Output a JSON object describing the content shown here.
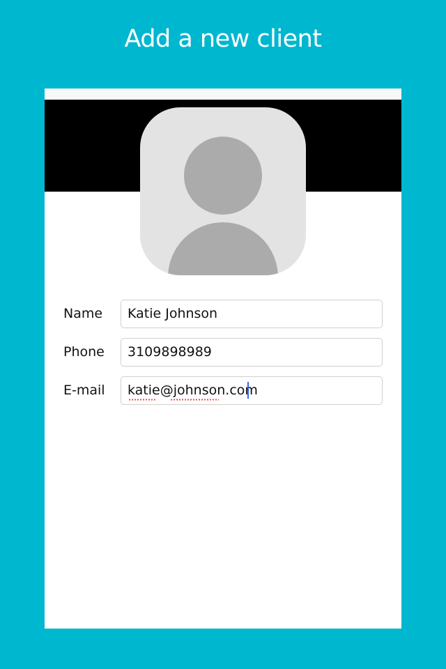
{
  "page": {
    "title": "Add a new client"
  },
  "colors": {
    "background": "#00B7D0",
    "card": "#FFFFFF",
    "header_band": "#000000",
    "avatar_bg": "#E3E3E3",
    "avatar_fg": "#ABABAB",
    "cursor": "#3B63E6",
    "spellcheck": "#E34B4B"
  },
  "avatar": {
    "icon": "person-placeholder-icon"
  },
  "form": {
    "name": {
      "label": "Name",
      "value": "Katie Johnson"
    },
    "phone": {
      "label": "Phone",
      "value": "3109898989"
    },
    "email": {
      "label": "E-mail",
      "value": "katie@johnson.com"
    }
  }
}
